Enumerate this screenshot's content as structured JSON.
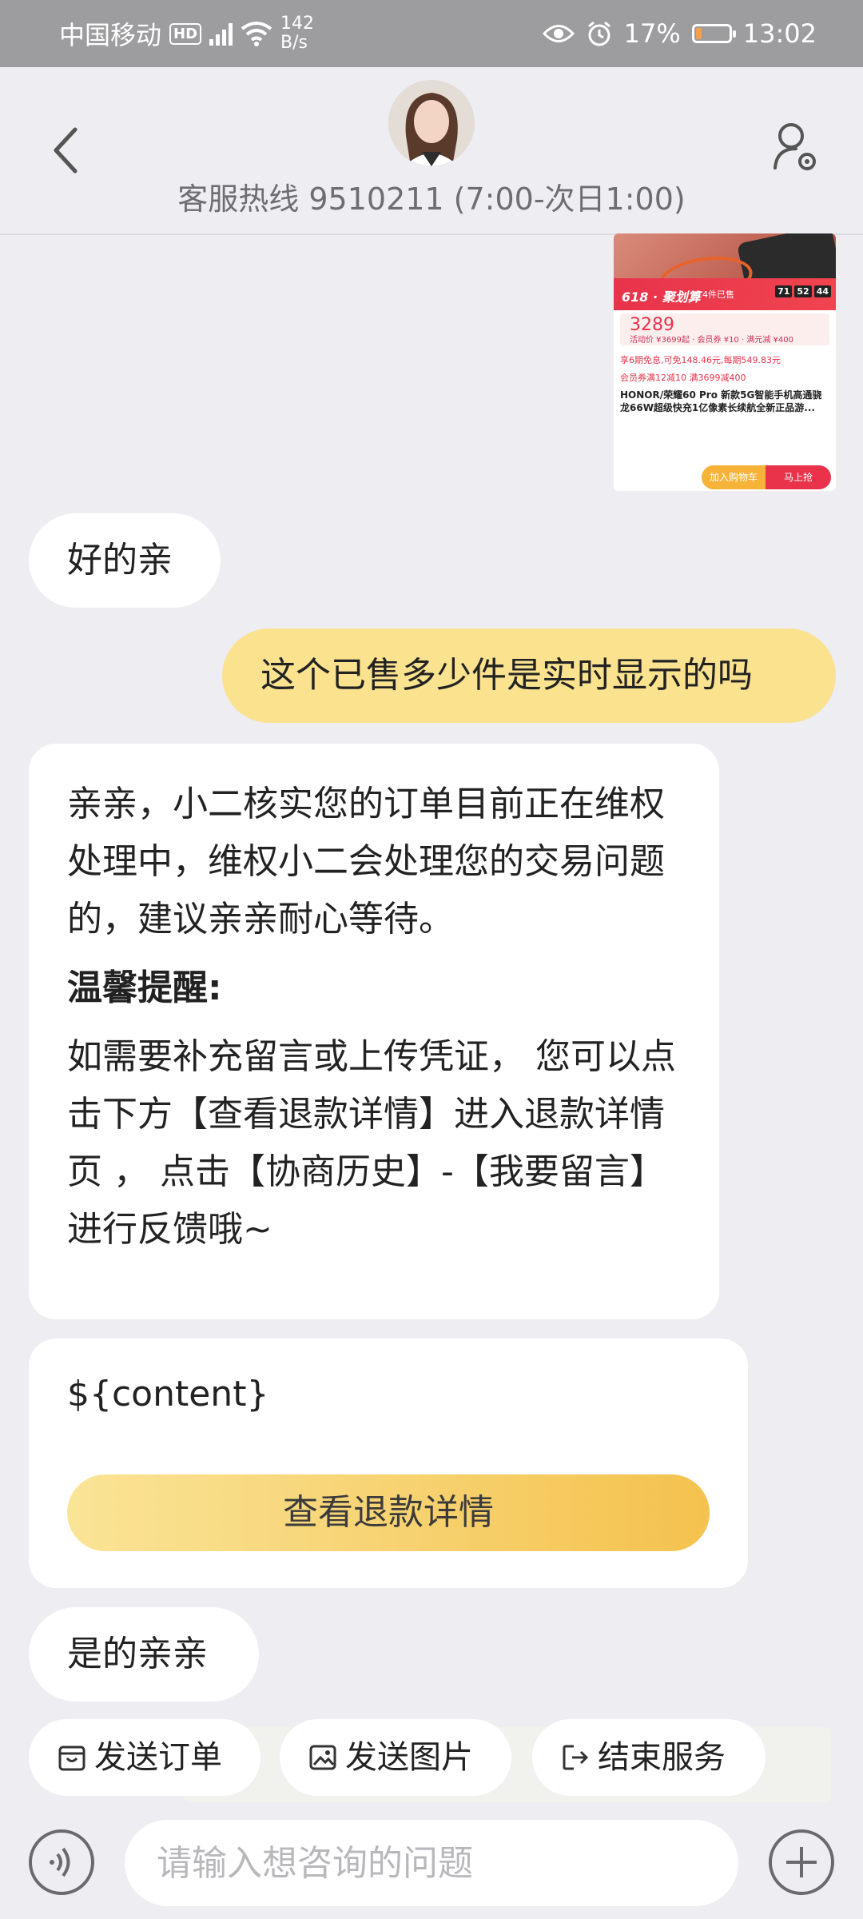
{
  "status_bar": {
    "carrier": "中国移动",
    "hd": "HD",
    "net_speed": "142",
    "net_unit": "B/s",
    "battery": "17%",
    "battery_level": 0.17,
    "time": "13:02"
  },
  "header": {
    "hotline": "客服热线 9510211 (7:00-次日1:00)"
  },
  "product_card": {
    "banner_left": "618 · 聚划算",
    "banner_mid": "14件已售",
    "countdown": [
      "71",
      "52",
      "44"
    ],
    "price": "3289",
    "price_sub": "活动价 ¥3699起 · 会员券 ¥10 · 满元减 ¥400",
    "lines": [
      "享6期免息,可免148.46元,每期549.83元",
      "会员券满12减10  满3699减400"
    ],
    "title": "HONOR/荣耀60 Pro 新款5G智能手机高通骁龙66W超级快充1亿像素长续航全新正品游...",
    "cart": "加入购物车",
    "buy": "马上抢"
  },
  "messages": {
    "agent_ok": "好的亲",
    "user_question": "这个已售多少件是实时显示的吗",
    "agent_long_p1": "亲亲，小二核实您的订单目前正在维权处理中，维权小二会处理您的交易问题的，建议亲亲耐心等待。",
    "agent_long_tip": "温馨提醒:",
    "agent_long_p2": "如需要补充留言或上传凭证， 您可以点击下方【查看退款详情】进入退款详情页 ， 点击【协商历史】-【我要留言】进行反馈哦~",
    "template_content": "${content}",
    "refund_button": "查看退款详情",
    "agent_yes": "是的亲亲"
  },
  "quick_actions": {
    "send_order": "发送订单",
    "send_image": "发送图片",
    "end_service": "结束服务"
  },
  "input": {
    "placeholder": "请输入想咨询的问题"
  }
}
